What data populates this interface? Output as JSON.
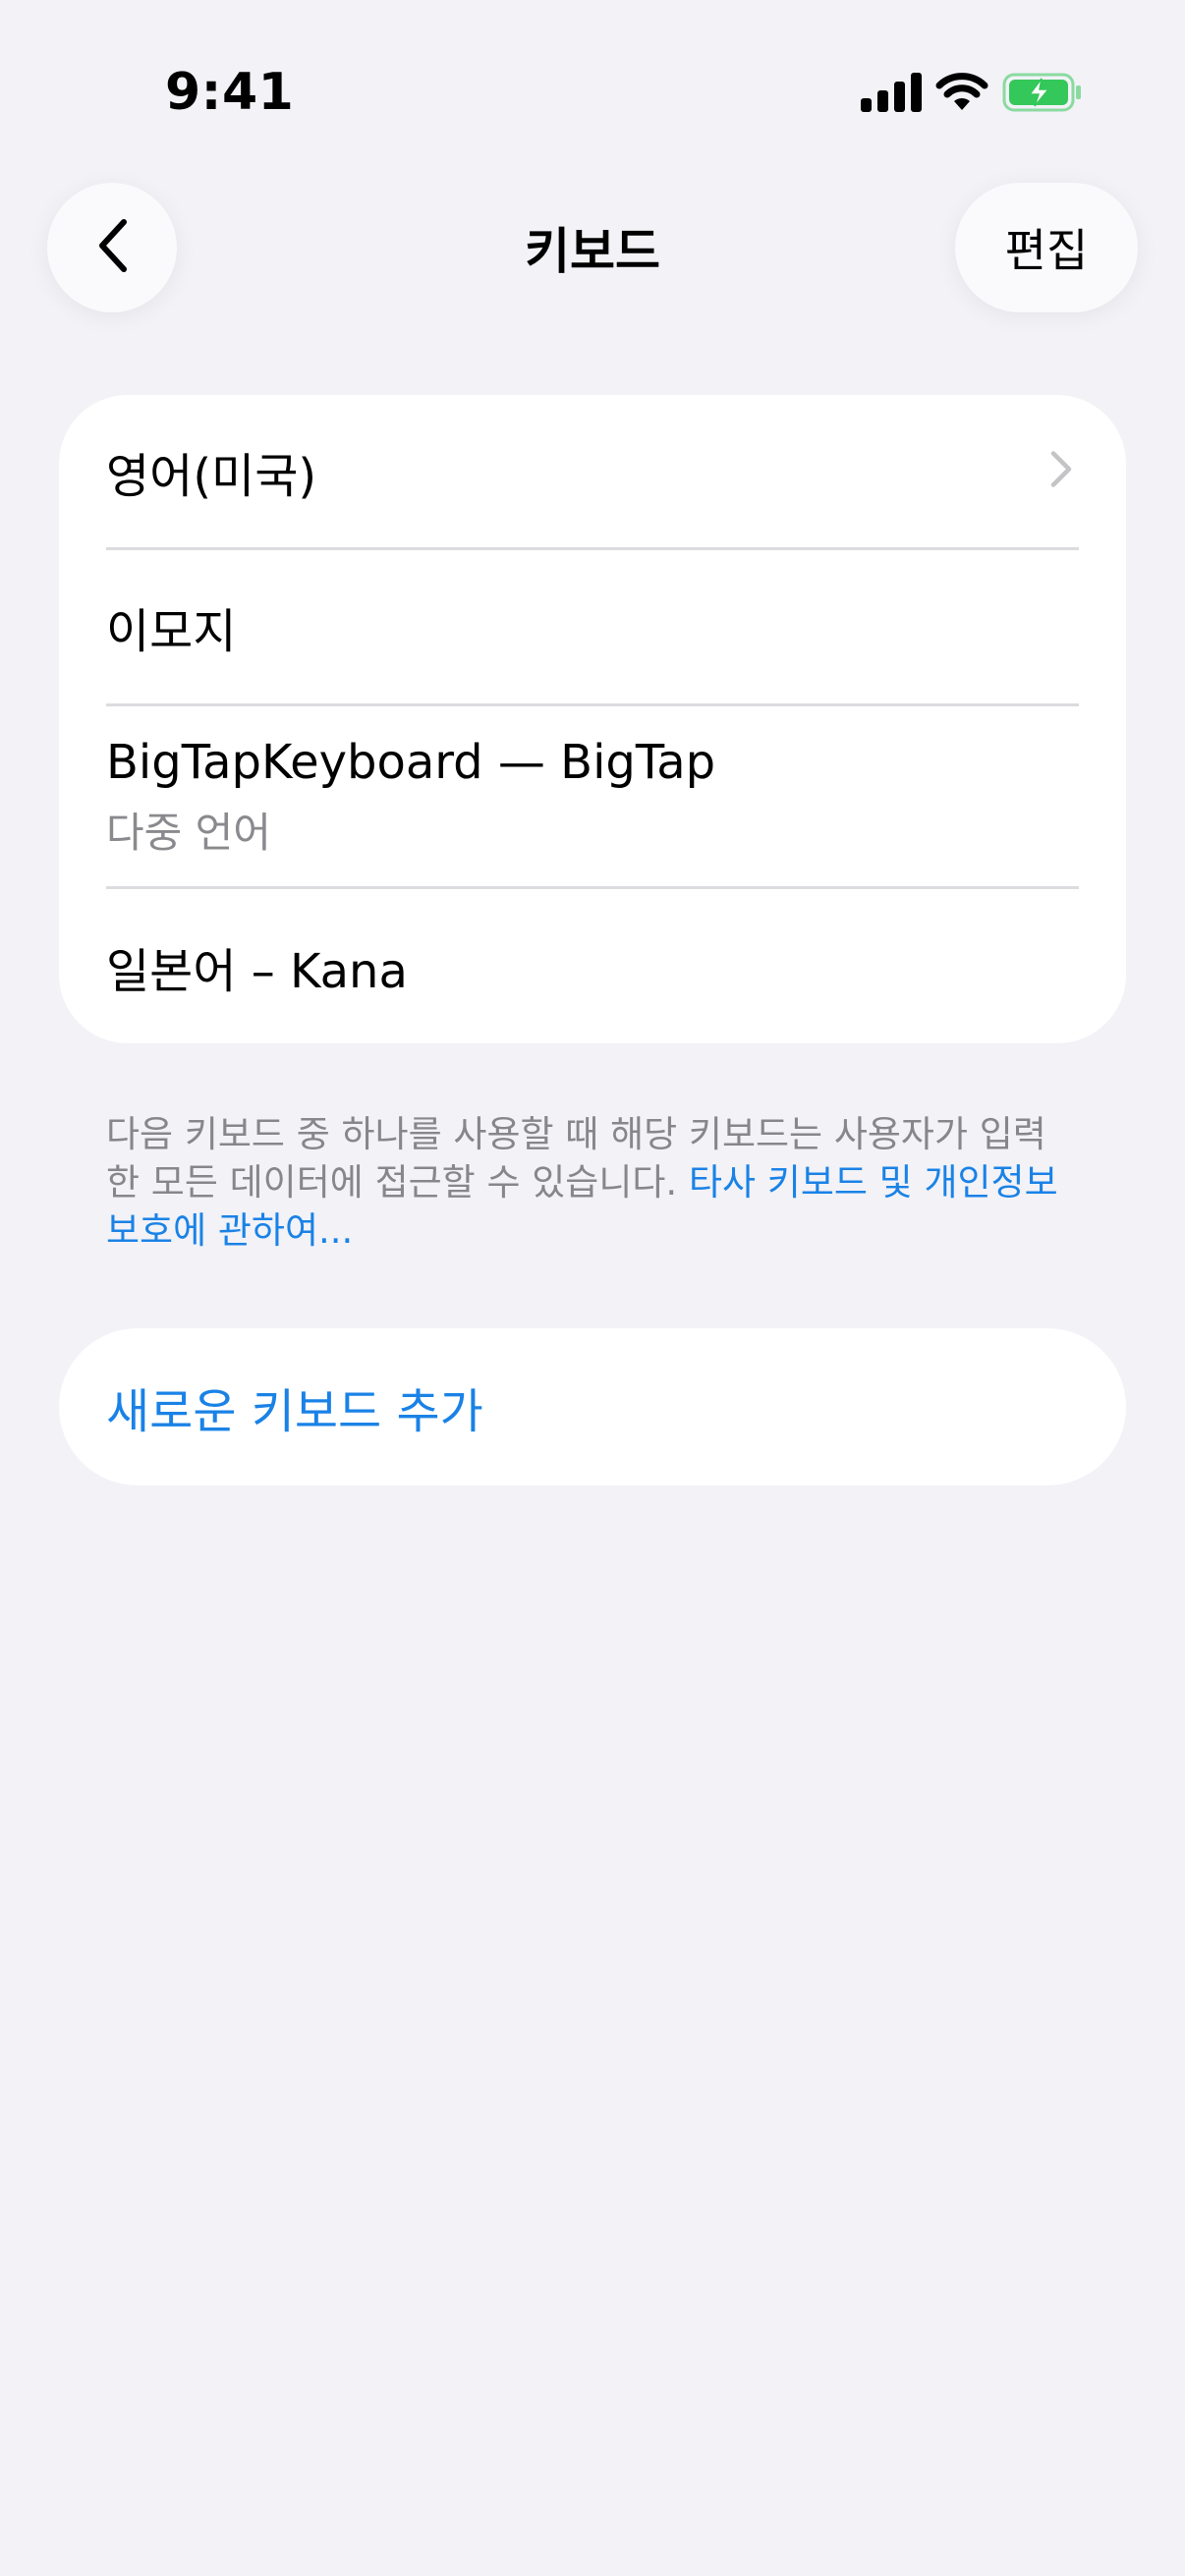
{
  "status_bar": {
    "time": "9:41",
    "icons": [
      "cellular-signal-icon",
      "wifi-icon",
      "battery-charging-icon"
    ],
    "battery_color": "#34c759"
  },
  "nav": {
    "back_icon": "chevron-left-icon",
    "title": "키보드",
    "edit_label": "편집"
  },
  "keyboards": [
    {
      "label": "영어(미국)",
      "sub": "",
      "has_chevron": true
    },
    {
      "label": "이모지",
      "sub": ""
    },
    {
      "label": "BigTapKeyboard — BigTap",
      "sub": "다중 언어"
    },
    {
      "label": "일본어 – Kana",
      "sub": ""
    }
  ],
  "footer": {
    "text": "다음 키보드 중 하나를 사용할 때 해당 키보드는 사용자가 입력한 모든 데이터에 접근할 수 있습니다. ",
    "link": "타사 키보드 및 개인정보 보호에 관하여..."
  },
  "add_keyboard": {
    "label": "새로운 키보드 추가"
  },
  "colors": {
    "background": "#f2f2f7",
    "accent": "#1a82e6",
    "secondary_text": "#86868b"
  }
}
